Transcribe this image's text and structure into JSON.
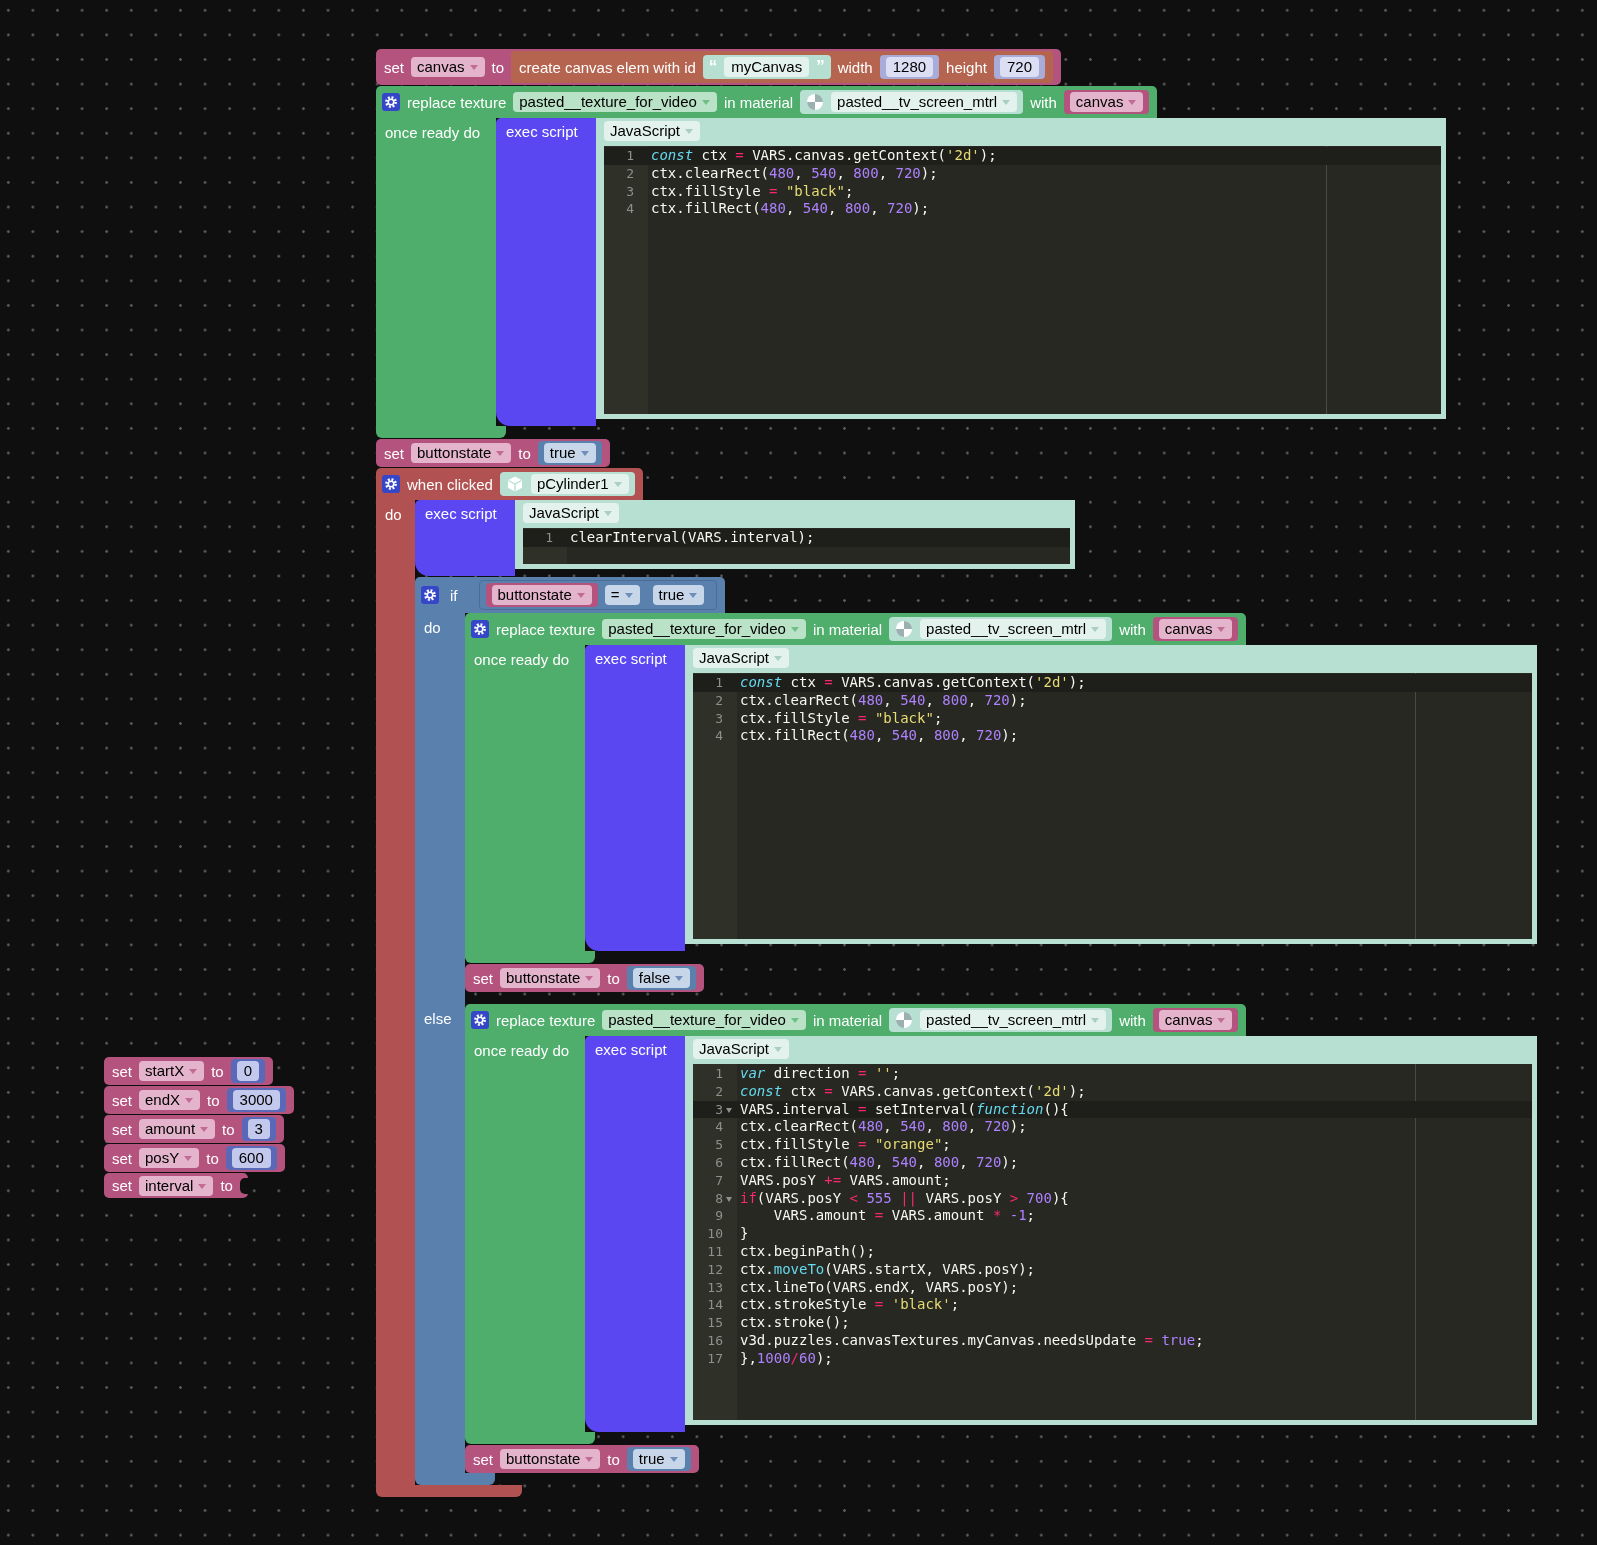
{
  "workspace": {
    "stacks": [
      {
        "blocks": [
          {
            "kind": "set",
            "label": "set",
            "variable": "canvas",
            "to_label": "to",
            "value": {
              "kind": "create_canvas",
              "label": "create canvas elem with id",
              "id": {
                "kind": "text",
                "open": "“",
                "text": "myCanvas",
                "close": "”"
              },
              "width_label": "width",
              "width": {
                "kind": "number",
                "text": "1280",
                "shadow": true
              },
              "height_label": "height",
              "height": {
                "kind": "number",
                "text": "720",
                "shadow": true
              }
            }
          },
          {
            "kind": "replace_texture",
            "label": "replace texture",
            "texture": "pasted__texture_for_video",
            "material_label": "in material",
            "material": {
              "kind": "material",
              "name": "pasted__tv_screen_mtrl"
            },
            "with_label": "with",
            "with": {
              "kind": "variable",
              "name": "canvas"
            },
            "ready_label": "once ready do",
            "body": [
              {
                "kind": "exec_script",
                "label": "exec script",
                "language": "JavaScript",
                "lines": [
                  {
                    "number": "1",
                    "active": true,
                    "fold": false,
                    "tokens": [
                      {
                        "kind": "kw",
                        "text": "const"
                      },
                      {
                        "kind": "plain",
                        "text": " ctx "
                      },
                      {
                        "kind": "op",
                        "text": "="
                      },
                      {
                        "kind": "plain",
                        "text": " VARS.canvas.getContext("
                      },
                      {
                        "kind": "str",
                        "text": "'2d'"
                      },
                      {
                        "kind": "plain",
                        "text": ");"
                      }
                    ]
                  },
                  {
                    "number": "2",
                    "active": false,
                    "fold": false,
                    "tokens": [
                      {
                        "kind": "plain",
                        "text": "ctx.clearRect("
                      },
                      {
                        "kind": "num",
                        "text": "480"
                      },
                      {
                        "kind": "plain",
                        "text": ", "
                      },
                      {
                        "kind": "num",
                        "text": "540"
                      },
                      {
                        "kind": "plain",
                        "text": ", "
                      },
                      {
                        "kind": "num",
                        "text": "800"
                      },
                      {
                        "kind": "plain",
                        "text": ", "
                      },
                      {
                        "kind": "num",
                        "text": "720"
                      },
                      {
                        "kind": "plain",
                        "text": ");"
                      }
                    ]
                  },
                  {
                    "number": "3",
                    "active": false,
                    "fold": false,
                    "tokens": [
                      {
                        "kind": "plain",
                        "text": "ctx.fillStyle "
                      },
                      {
                        "kind": "op",
                        "text": "="
                      },
                      {
                        "kind": "str",
                        "text": " \"black\""
                      },
                      {
                        "kind": "plain",
                        "text": ";"
                      }
                    ]
                  },
                  {
                    "number": "4",
                    "active": false,
                    "fold": false,
                    "tokens": [
                      {
                        "kind": "plain",
                        "text": "ctx.fillRect("
                      },
                      {
                        "kind": "num",
                        "text": "480"
                      },
                      {
                        "kind": "plain",
                        "text": ", "
                      },
                      {
                        "kind": "num",
                        "text": "540"
                      },
                      {
                        "kind": "plain",
                        "text": ", "
                      },
                      {
                        "kind": "num",
                        "text": "800"
                      },
                      {
                        "kind": "plain",
                        "text": ", "
                      },
                      {
                        "kind": "num",
                        "text": "720"
                      },
                      {
                        "kind": "plain",
                        "text": ");"
                      }
                    ]
                  }
                ]
              }
            ]
          },
          {
            "kind": "set",
            "label": "set",
            "variable": "buttonstate",
            "to_label": "to",
            "value": {
              "kind": "boolean",
              "text": "true"
            }
          },
          {
            "kind": "when_clicked",
            "label": "when clicked",
            "object": {
              "kind": "object",
              "name": "pCylinder1"
            },
            "do_label": "do",
            "body": [
              {
                "kind": "exec_script",
                "label": "exec script",
                "language": "JavaScript",
                "lines": [
                  {
                    "number": "1",
                    "active": true,
                    "fold": false,
                    "tokens": [
                      {
                        "kind": "plain",
                        "text": "clearInterval(VARS.interval);"
                      }
                    ]
                  }
                ]
              },
              {
                "kind": "if_else",
                "label": "if",
                "condition": {
                  "kind": "compare",
                  "left": {
                    "kind": "variable",
                    "name": "buttonstate"
                  },
                  "operator": "=",
                  "right": {
                    "kind": "boolean",
                    "text": "true"
                  }
                },
                "do_label": "do",
                "do": [
                  {
                    "kind": "replace_texture",
                    "label": "replace texture",
                    "texture": "pasted__texture_for_video",
                    "material_label": "in material",
                    "material": {
                      "kind": "material",
                      "name": "pasted__tv_screen_mtrl"
                    },
                    "with_label": "with",
                    "with": {
                      "kind": "variable",
                      "name": "canvas"
                    },
                    "ready_label": "once ready do",
                    "body": [
                      {
                        "kind": "exec_script",
                        "label": "exec script",
                        "language": "JavaScript",
                        "lines": [
                          {
                            "number": "1",
                            "active": true,
                            "fold": false,
                            "tokens": [
                              {
                                "kind": "kw",
                                "text": "const"
                              },
                              {
                                "kind": "plain",
                                "text": " ctx "
                              },
                              {
                                "kind": "op",
                                "text": "="
                              },
                              {
                                "kind": "plain",
                                "text": " VARS.canvas.getContext("
                              },
                              {
                                "kind": "str",
                                "text": "'2d'"
                              },
                              {
                                "kind": "plain",
                                "text": ");"
                              }
                            ]
                          },
                          {
                            "number": "2",
                            "active": false,
                            "fold": false,
                            "tokens": [
                              {
                                "kind": "plain",
                                "text": "ctx.clearRect("
                              },
                              {
                                "kind": "num",
                                "text": "480"
                              },
                              {
                                "kind": "plain",
                                "text": ", "
                              },
                              {
                                "kind": "num",
                                "text": "540"
                              },
                              {
                                "kind": "plain",
                                "text": ", "
                              },
                              {
                                "kind": "num",
                                "text": "800"
                              },
                              {
                                "kind": "plain",
                                "text": ", "
                              },
                              {
                                "kind": "num",
                                "text": "720"
                              },
                              {
                                "kind": "plain",
                                "text": ");"
                              }
                            ]
                          },
                          {
                            "number": "3",
                            "active": false,
                            "fold": false,
                            "tokens": [
                              {
                                "kind": "plain",
                                "text": "ctx.fillStyle "
                              },
                              {
                                "kind": "op",
                                "text": "="
                              },
                              {
                                "kind": "str",
                                "text": " \"black\""
                              },
                              {
                                "kind": "plain",
                                "text": ";"
                              }
                            ]
                          },
                          {
                            "number": "4",
                            "active": false,
                            "fold": false,
                            "tokens": [
                              {
                                "kind": "plain",
                                "text": "ctx.fillRect("
                              },
                              {
                                "kind": "num",
                                "text": "480"
                              },
                              {
                                "kind": "plain",
                                "text": ", "
                              },
                              {
                                "kind": "num",
                                "text": "540"
                              },
                              {
                                "kind": "plain",
                                "text": ", "
                              },
                              {
                                "kind": "num",
                                "text": "800"
                              },
                              {
                                "kind": "plain",
                                "text": ", "
                              },
                              {
                                "kind": "num",
                                "text": "720"
                              },
                              {
                                "kind": "plain",
                                "text": ");"
                              }
                            ]
                          }
                        ]
                      }
                    ]
                  },
                  {
                    "kind": "set",
                    "label": "set",
                    "variable": "buttonstate",
                    "to_label": "to",
                    "value": {
                      "kind": "boolean",
                      "text": "false"
                    }
                  }
                ],
                "else_label": "else",
                "else": [
                  {
                    "kind": "replace_texture",
                    "label": "replace texture",
                    "texture": "pasted__texture_for_video",
                    "material_label": "in material",
                    "material": {
                      "kind": "material",
                      "name": "pasted__tv_screen_mtrl"
                    },
                    "with_label": "with",
                    "with": {
                      "kind": "variable",
                      "name": "canvas"
                    },
                    "ready_label": "once ready do",
                    "body": [
                      {
                        "kind": "exec_script",
                        "label": "exec script",
                        "language": "JavaScript",
                        "lines": [
                          {
                            "number": "1",
                            "active": false,
                            "fold": false,
                            "tokens": [
                              {
                                "kind": "kw",
                                "text": "var"
                              },
                              {
                                "kind": "plain",
                                "text": " direction "
                              },
                              {
                                "kind": "op",
                                "text": "="
                              },
                              {
                                "kind": "str",
                                "text": " ''"
                              },
                              {
                                "kind": "plain",
                                "text": ";"
                              }
                            ]
                          },
                          {
                            "number": "2",
                            "active": false,
                            "fold": false,
                            "tokens": [
                              {
                                "kind": "kw",
                                "text": "const"
                              },
                              {
                                "kind": "plain",
                                "text": " ctx "
                              },
                              {
                                "kind": "op",
                                "text": "="
                              },
                              {
                                "kind": "plain",
                                "text": " VARS.canvas.getContext("
                              },
                              {
                                "kind": "str",
                                "text": "'2d'"
                              },
                              {
                                "kind": "plain",
                                "text": ");"
                              }
                            ]
                          },
                          {
                            "number": "3",
                            "active": true,
                            "fold": true,
                            "tokens": [
                              {
                                "kind": "plain",
                                "text": "VARS.interval "
                              },
                              {
                                "kind": "op",
                                "text": "="
                              },
                              {
                                "kind": "plain",
                                "text": " setInterval("
                              },
                              {
                                "kind": "kw",
                                "text": "function"
                              },
                              {
                                "kind": "plain",
                                "text": "(){"
                              }
                            ]
                          },
                          {
                            "number": "4",
                            "active": false,
                            "fold": false,
                            "tokens": [
                              {
                                "kind": "plain",
                                "text": "ctx.clearRect("
                              },
                              {
                                "kind": "num",
                                "text": "480"
                              },
                              {
                                "kind": "plain",
                                "text": ", "
                              },
                              {
                                "kind": "num",
                                "text": "540"
                              },
                              {
                                "kind": "plain",
                                "text": ", "
                              },
                              {
                                "kind": "num",
                                "text": "800"
                              },
                              {
                                "kind": "plain",
                                "text": ", "
                              },
                              {
                                "kind": "num",
                                "text": "720"
                              },
                              {
                                "kind": "plain",
                                "text": ");"
                              }
                            ]
                          },
                          {
                            "number": "5",
                            "active": false,
                            "fold": false,
                            "tokens": [
                              {
                                "kind": "plain",
                                "text": "ctx.fillStyle "
                              },
                              {
                                "kind": "op",
                                "text": "="
                              },
                              {
                                "kind": "str",
                                "text": " \"orange\""
                              },
                              {
                                "kind": "plain",
                                "text": ";"
                              }
                            ]
                          },
                          {
                            "number": "6",
                            "active": false,
                            "fold": false,
                            "tokens": [
                              {
                                "kind": "plain",
                                "text": "ctx.fillRect("
                              },
                              {
                                "kind": "num",
                                "text": "480"
                              },
                              {
                                "kind": "plain",
                                "text": ", "
                              },
                              {
                                "kind": "num",
                                "text": "540"
                              },
                              {
                                "kind": "plain",
                                "text": ", "
                              },
                              {
                                "kind": "num",
                                "text": "800"
                              },
                              {
                                "kind": "plain",
                                "text": ", "
                              },
                              {
                                "kind": "num",
                                "text": "720"
                              },
                              {
                                "kind": "plain",
                                "text": ");"
                              }
                            ]
                          },
                          {
                            "number": "7",
                            "active": false,
                            "fold": false,
                            "tokens": [
                              {
                                "kind": "plain",
                                "text": "VARS.posY "
                              },
                              {
                                "kind": "op",
                                "text": "+="
                              },
                              {
                                "kind": "plain",
                                "text": " VARS.amount;"
                              }
                            ]
                          },
                          {
                            "number": "8",
                            "active": false,
                            "fold": true,
                            "tokens": [
                              {
                                "kind": "op",
                                "text": "if"
                              },
                              {
                                "kind": "plain",
                                "text": "(VARS.posY "
                              },
                              {
                                "kind": "op",
                                "text": "<"
                              },
                              {
                                "kind": "num",
                                "text": " 555"
                              },
                              {
                                "kind": "op",
                                "text": " ||"
                              },
                              {
                                "kind": "plain",
                                "text": " VARS.posY "
                              },
                              {
                                "kind": "op",
                                "text": ">"
                              },
                              {
                                "kind": "num",
                                "text": " 700"
                              },
                              {
                                "kind": "plain",
                                "text": "){"
                              }
                            ]
                          },
                          {
                            "number": "9",
                            "active": false,
                            "fold": false,
                            "tokens": [
                              {
                                "kind": "plain",
                                "text": "    VARS.amount "
                              },
                              {
                                "kind": "op",
                                "text": "="
                              },
                              {
                                "kind": "plain",
                                "text": " VARS.amount "
                              },
                              {
                                "kind": "op",
                                "text": "*"
                              },
                              {
                                "kind": "num",
                                "text": " -1"
                              },
                              {
                                "kind": "plain",
                                "text": ";"
                              }
                            ]
                          },
                          {
                            "number": "10",
                            "active": false,
                            "fold": false,
                            "tokens": [
                              {
                                "kind": "plain",
                                "text": "}"
                              }
                            ]
                          },
                          {
                            "number": "11",
                            "active": false,
                            "fold": false,
                            "tokens": [
                              {
                                "kind": "plain",
                                "text": "ctx.beginPath();"
                              }
                            ]
                          },
                          {
                            "number": "12",
                            "active": false,
                            "fold": false,
                            "tokens": [
                              {
                                "kind": "plain",
                                "text": "ctx."
                              },
                              {
                                "kind": "fn",
                                "text": "moveTo"
                              },
                              {
                                "kind": "plain",
                                "text": "(VARS.startX, VARS.posY);"
                              }
                            ]
                          },
                          {
                            "number": "13",
                            "active": false,
                            "fold": false,
                            "tokens": [
                              {
                                "kind": "plain",
                                "text": "ctx.lineTo(VARS.endX, VARS.posY);"
                              }
                            ]
                          },
                          {
                            "number": "14",
                            "active": false,
                            "fold": false,
                            "tokens": [
                              {
                                "kind": "plain",
                                "text": "ctx.strokeStyle "
                              },
                              {
                                "kind": "op",
                                "text": "="
                              },
                              {
                                "kind": "str",
                                "text": " 'black'"
                              },
                              {
                                "kind": "plain",
                                "text": ";"
                              }
                            ]
                          },
                          {
                            "number": "15",
                            "active": false,
                            "fold": false,
                            "tokens": [
                              {
                                "kind": "plain",
                                "text": "ctx.stroke();"
                              }
                            ]
                          },
                          {
                            "number": "16",
                            "active": false,
                            "fold": false,
                            "tokens": [
                              {
                                "kind": "plain",
                                "text": "v3d.puzzles.canvasTextures.myCanvas.needsUpdate "
                              },
                              {
                                "kind": "op",
                                "text": "="
                              },
                              {
                                "kind": "atom",
                                "text": " true"
                              },
                              {
                                "kind": "plain",
                                "text": ";"
                              }
                            ]
                          },
                          {
                            "number": "17",
                            "active": false,
                            "fold": false,
                            "tokens": [
                              {
                                "kind": "plain",
                                "text": "},"
                              },
                              {
                                "kind": "num",
                                "text": "1000"
                              },
                              {
                                "kind": "op",
                                "text": "/"
                              },
                              {
                                "kind": "num",
                                "text": "60"
                              },
                              {
                                "kind": "plain",
                                "text": ");"
                              }
                            ]
                          }
                        ]
                      }
                    ]
                  },
                  {
                    "kind": "set",
                    "label": "set",
                    "variable": "buttonstate",
                    "to_label": "to",
                    "value": {
                      "kind": "boolean",
                      "text": "true"
                    }
                  }
                ]
              }
            ]
          }
        ]
      },
      {
        "blocks": [
          {
            "kind": "set",
            "label": "set",
            "variable": "startX",
            "to_label": "to",
            "value": {
              "kind": "number",
              "text": "0",
              "shadow": false
            }
          },
          {
            "kind": "set",
            "label": "set",
            "variable": "endX",
            "to_label": "to",
            "value": {
              "kind": "number",
              "text": "3000",
              "shadow": false
            }
          },
          {
            "kind": "set",
            "label": "set",
            "variable": "amount",
            "to_label": "to",
            "value": {
              "kind": "number",
              "text": "3",
              "shadow": false
            }
          },
          {
            "kind": "set",
            "label": "set",
            "variable": "posY",
            "to_label": "to",
            "value": {
              "kind": "number",
              "text": "600",
              "shadow": false
            }
          },
          {
            "kind": "set",
            "label": "set",
            "variable": "interval",
            "to_label": "to"
          }
        ]
      }
    ]
  }
}
